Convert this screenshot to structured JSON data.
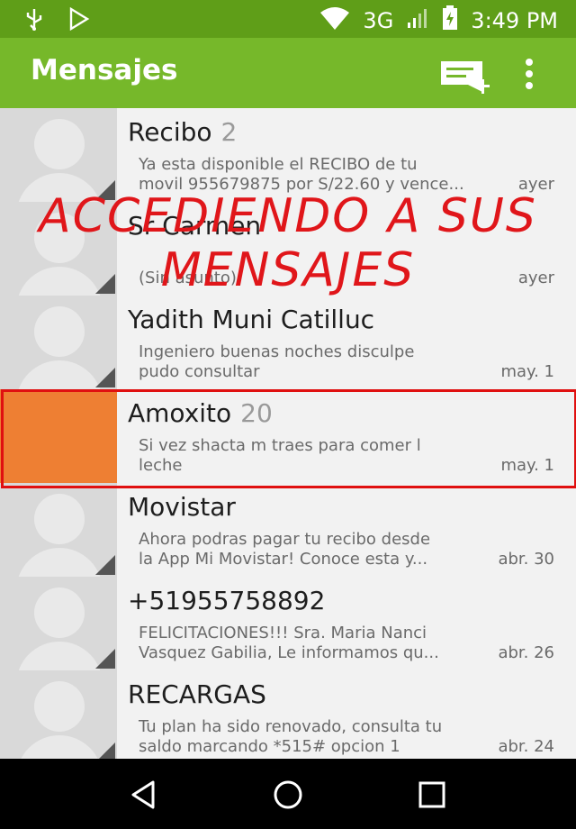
{
  "status_bar": {
    "network": "3G",
    "time": "3:49 PM",
    "icons": [
      "usb-icon",
      "play-store-icon",
      "wifi-icon",
      "signal-icon",
      "battery-icon"
    ]
  },
  "app_bar": {
    "title": "Mensajes",
    "color": "#76b82a",
    "actions": [
      "new-message-icon",
      "overflow-menu-icon"
    ]
  },
  "overlay_text": {
    "line1": "ACCEDIENDO A SUS",
    "line2": "MENSAJES",
    "color": "#e0161a"
  },
  "conversations": [
    {
      "name": "Recibo",
      "count": "2",
      "snippet": "Ya esta disponible el RECIBO de tu\nmovil 955679875 por S/22.60 y vence...",
      "date": "ayer"
    },
    {
      "name": "Sr Carmen",
      "count": "",
      "snippet": "\n(Sin asunto)",
      "date": "ayer"
    },
    {
      "name": "Yadith Muni Catilluc",
      "count": "",
      "snippet": " Ingeniero buenas noches disculpe\npudo consultar",
      "date": "may. 1"
    },
    {
      "name": "Amoxito",
      "count": "20",
      "snippet": "Si vez shacta m traes para comer l\nleche",
      "date": "may. 1",
      "highlighted": true
    },
    {
      "name": "Movistar",
      "count": "",
      "snippet": "Ahora podras pagar tu recibo desde\nla App Mi Movistar! Conoce esta y...",
      "date": "abr. 30"
    },
    {
      "name": "+51955758892",
      "count": "",
      "snippet": "FELICITACIONES!!! Sra. Maria Nanci\nVasquez Gabilia,  Le informamos qu...",
      "date": "abr. 26"
    },
    {
      "name": "RECARGAS",
      "count": "",
      "snippet": "Tu plan ha sido renovado, consulta tu\nsaldo marcando *515# opcion 1",
      "date": "abr. 24"
    }
  ],
  "nav_bar": {
    "buttons": [
      "back-icon",
      "home-icon",
      "recents-icon"
    ]
  }
}
